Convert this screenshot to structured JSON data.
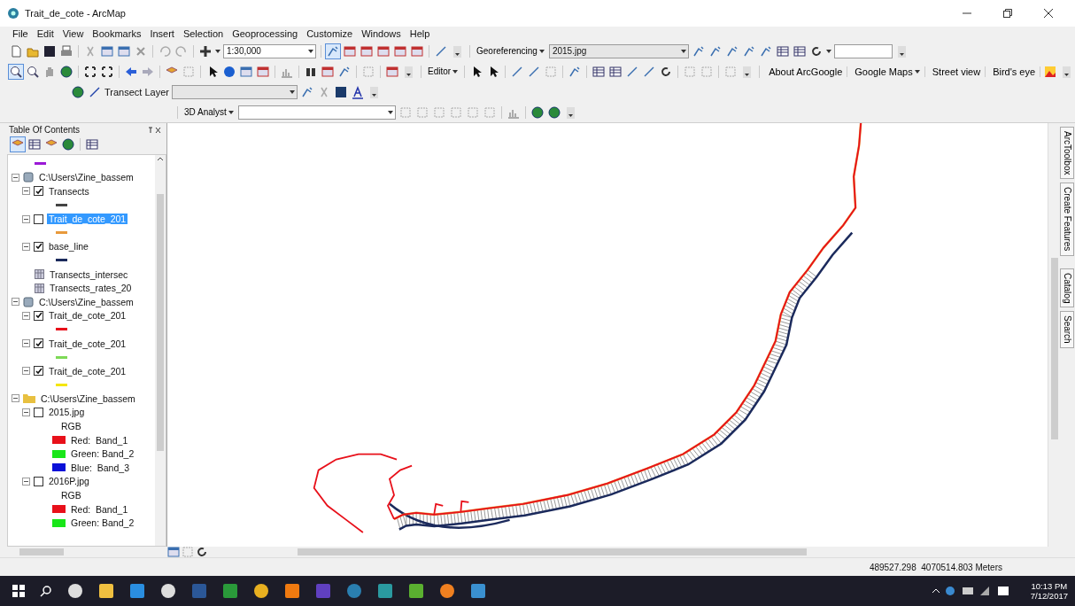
{
  "window": {
    "title": "Trait_de_cote - ArcMap"
  },
  "menu": [
    "File",
    "Edit",
    "View",
    "Bookmarks",
    "Insert",
    "Selection",
    "Geoprocessing",
    "Customize",
    "Windows",
    "Help"
  ],
  "toolbars": {
    "scale": {
      "value": "1:30,000"
    },
    "georeferencing": {
      "label": "Georeferencing"
    },
    "georef_layer": {
      "value": "2015.jpg"
    },
    "editor": {
      "label": "Editor"
    },
    "arcgoogle": [
      {
        "label": "About ArcGoogle",
        "kind": "link"
      },
      {
        "label": "Google Maps",
        "kind": "dropdown"
      },
      {
        "label": "Street view",
        "kind": "link"
      },
      {
        "label": "Bird's eye",
        "kind": "link"
      }
    ],
    "transect_label": "Transect Layer",
    "analyst": {
      "label": "3D Analyst"
    }
  },
  "toc": {
    "title": "Table Of Contents",
    "tree": [
      {
        "kind": "line",
        "color": "#9b19d6"
      },
      {
        "kind": "group",
        "label": "C:\\Users\\Zine_bassem",
        "expanded": true,
        "children": [
          {
            "kind": "layer",
            "label": "Transects",
            "checked": true,
            "selected": false,
            "expanded": true,
            "children": [
              {
                "kind": "line",
                "color": "#444444"
              }
            ]
          },
          {
            "kind": "layer",
            "label": "Trait_de_cote_201",
            "checked": false,
            "selected": true,
            "expanded": true,
            "children": [
              {
                "kind": "line",
                "color": "#e89a3c"
              }
            ]
          },
          {
            "kind": "layer",
            "label": "base_line",
            "checked": true,
            "selected": false,
            "expanded": true,
            "children": [
              {
                "kind": "line",
                "color": "#1b2a5c"
              }
            ]
          },
          {
            "kind": "table",
            "label": "Transects_intersec"
          },
          {
            "kind": "table",
            "label": "Transects_rates_20"
          }
        ]
      },
      {
        "kind": "group",
        "label": "C:\\Users\\Zine_bassem",
        "expanded": true,
        "children": [
          {
            "kind": "layer",
            "label": "Trait_de_cote_201",
            "checked": true,
            "selected": false,
            "expanded": true,
            "children": [
              {
                "kind": "line",
                "color": "#e8101a"
              }
            ]
          },
          {
            "kind": "layer",
            "label": "Trait_de_cote_201",
            "checked": true,
            "selected": false,
            "expanded": true,
            "children": [
              {
                "kind": "line",
                "color": "#7ed957"
              }
            ]
          },
          {
            "kind": "layer",
            "label": "Trait_de_cote_201",
            "checked": true,
            "selected": false,
            "expanded": true,
            "children": [
              {
                "kind": "line",
                "color": "#f5e60a"
              }
            ]
          }
        ]
      },
      {
        "kind": "folder",
        "label": "C:\\Users\\Zine_bassem",
        "expanded": true,
        "children": [
          {
            "kind": "layer",
            "label": "2015.jpg",
            "checked": false,
            "selected": false,
            "expanded": true,
            "children": [
              {
                "kind": "caption",
                "label": "RGB"
              },
              {
                "kind": "band",
                "label": "Red:  Band_1",
                "color": "#e8101a"
              },
              {
                "kind": "band",
                "label": "Green: Band_2",
                "color": "#19e619"
              },
              {
                "kind": "band",
                "label": "Blue:  Band_3",
                "color": "#0a10d8"
              }
            ]
          },
          {
            "kind": "layer",
            "label": "2016P.jpg",
            "checked": false,
            "selected": false,
            "expanded": true,
            "children": [
              {
                "kind": "caption",
                "label": "RGB"
              },
              {
                "kind": "band",
                "label": "Red:  Band_1",
                "color": "#e8101a"
              },
              {
                "kind": "band",
                "label": "Green: Band_2",
                "color": "#19e619"
              }
            ]
          }
        ]
      }
    ]
  },
  "dock_tabs": [
    "ArcToolbox",
    "Create Features",
    "Catalog",
    "Search"
  ],
  "status": {
    "coordinates": "489527.298  4070514.803 Meters"
  },
  "taskbar": {
    "time": "10:13 PM",
    "date": "7/12/2017"
  }
}
